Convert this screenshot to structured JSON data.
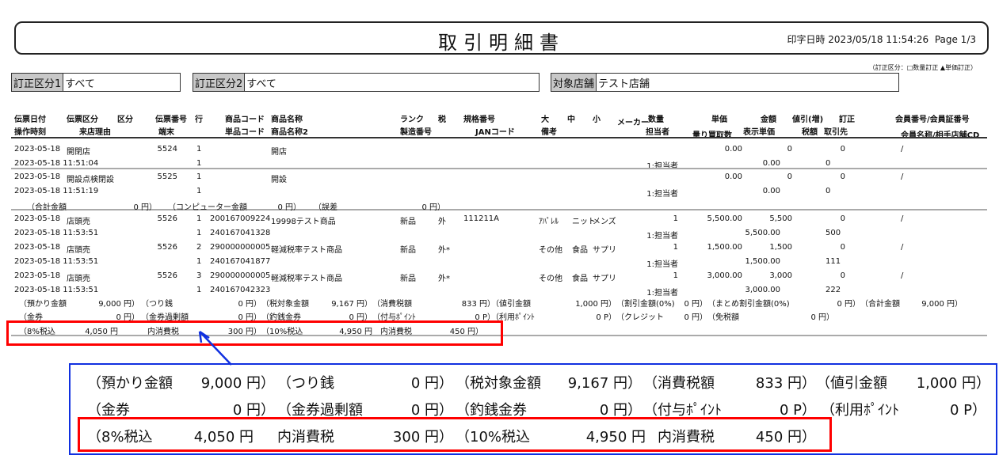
{
  "header": {
    "title": "取引明細書",
    "printed": "印字日時 2023/05/18 11:54:26",
    "page": "Page 1/3",
    "legend": "（訂正区分：□数量訂正 ▲単価訂正）"
  },
  "filters": [
    {
      "label": "訂正区分1",
      "value": "すべて"
    },
    {
      "label": "訂正区分2",
      "value": "すべて"
    },
    {
      "label": "対象店舗",
      "value": "テスト店舗"
    }
  ],
  "columns1": [
    "伝票日付",
    "伝票区分",
    "区分",
    "伝票番号",
    "行",
    "商品コード",
    "商品名称",
    "ランク",
    "税",
    "規格番号",
    "大",
    "中",
    "小",
    "メーカー",
    "数量",
    "単価",
    "金額",
    "値引(増)",
    "訂正",
    "会員番号/会員証番号"
  ],
  "columns2": [
    "操作時刻",
    "来店理由",
    "端末",
    "単品コード",
    "商品名称2",
    "製造番号",
    "JANコード",
    "備考",
    "担当者",
    "量り買取数",
    "表示単価",
    "税額",
    "取引先",
    "会員名称/相手店舗CD"
  ],
  "rows": [
    {
      "date": "2023-05-18",
      "kubun": "開閉店",
      "slip": "5524",
      "line": "1",
      "name": "開店",
      "tanka": "0.00",
      "kingaku": "0",
      "nebiki": "0",
      "member": "/",
      "time": "2023-05-18 11:51:04",
      "term": "1",
      "staff": "1:担当者",
      "disp": "0.00",
      "tax": "0"
    },
    {
      "date": "2023-05-18",
      "kubun": "開設点検閉設",
      "slip": "5525",
      "line": "1",
      "name": "開設",
      "tanka": "0.00",
      "kingaku": "0",
      "nebiki": "0",
      "member": "/",
      "time": "2023-05-18 11:51:19",
      "term": "1",
      "staff": "1:担当者",
      "disp": "0.00",
      "tax": "0"
    },
    {
      "date": "2023-05-18",
      "kubun": "店頭売",
      "slip": "5526",
      "line": "1",
      "code": "200167009224",
      "name": "19998テスト商品",
      "rank": "新品",
      "taxk": "外",
      "kikaku": "111211A",
      "dai": "ｱﾊﾟﾚﾙ",
      "chu": "ニット",
      "sho": "メンズ",
      "qty": "1",
      "tanka": "5,500.00",
      "kingaku": "5,500",
      "nebiki": "0",
      "member": "/",
      "time": "2023-05-18 11:53:51",
      "term": "1",
      "code2": "240167041328",
      "staff": "1:担当者",
      "disp": "5,500.00",
      "tax": "500"
    },
    {
      "date": "2023-05-18",
      "kubun": "店頭売",
      "slip": "5526",
      "line": "2",
      "code": "290000000005",
      "name": "軽減税率テスト商品",
      "rank": "新品",
      "taxk": "外*",
      "dai": "その他",
      "chu": "食品",
      "sho": "サプリ",
      "qty": "1",
      "tanka": "1,500.00",
      "kingaku": "1,500",
      "nebiki": "0",
      "member": "/",
      "time": "2023-05-18 11:53:51",
      "term": "1",
      "code2": "240167041877",
      "staff": "1:担当者",
      "disp": "1,500.00",
      "tax": "111"
    },
    {
      "date": "2023-05-18",
      "kubun": "店頭売",
      "slip": "5526",
      "line": "3",
      "code": "290000000005",
      "name": "軽減税率テスト商品",
      "rank": "新品",
      "taxk": "外*",
      "dai": "その他",
      "chu": "食品",
      "sho": "サプリ",
      "qty": "1",
      "tanka": "3,000.00",
      "kingaku": "3,000",
      "nebiki": "0",
      "member": "/",
      "time": "2023-05-18 11:53:51",
      "term": "1",
      "code2": "240167042323",
      "staff": "1:担当者",
      "disp": "3,000.00",
      "tax": "222"
    }
  ],
  "subtotal": {
    "l1": "（合計金額",
    "v1": "0 円）",
    "l2": "（コンピューター金額",
    "v2": "0 円）",
    "l3": "（誤差",
    "v3": "0 円）"
  },
  "summary": {
    "line1": [
      "（預かり金額",
      "9,000 円）",
      "（つり銭",
      "0 円）",
      "（税対象金額",
      "9,167 円）",
      "（消費税額",
      "833 円）",
      "（値引金額",
      "1,000 円）",
      "（割引金額(0%)",
      "0 円）",
      "（まとめ割引金額(0%)",
      "0 円）",
      "（合計金額",
      "9,000 円）"
    ],
    "line2": [
      "（金券",
      "0 円）",
      "（金券過剰額",
      "0 円）",
      "（釣銭金券",
      "0 円）",
      "（付与ﾎﾟｲﾝﾄ",
      "0 P）",
      "（利用ﾎﾟｲﾝﾄ",
      "0 P）",
      "（クレジット",
      "0 円）",
      "（免税額",
      "0 円）"
    ],
    "line3": [
      "（8%税込",
      "4,050 円",
      "内消費税",
      "300 円）",
      "（10%税込",
      "4,950 円",
      "内消費税",
      "450 円）"
    ]
  }
}
